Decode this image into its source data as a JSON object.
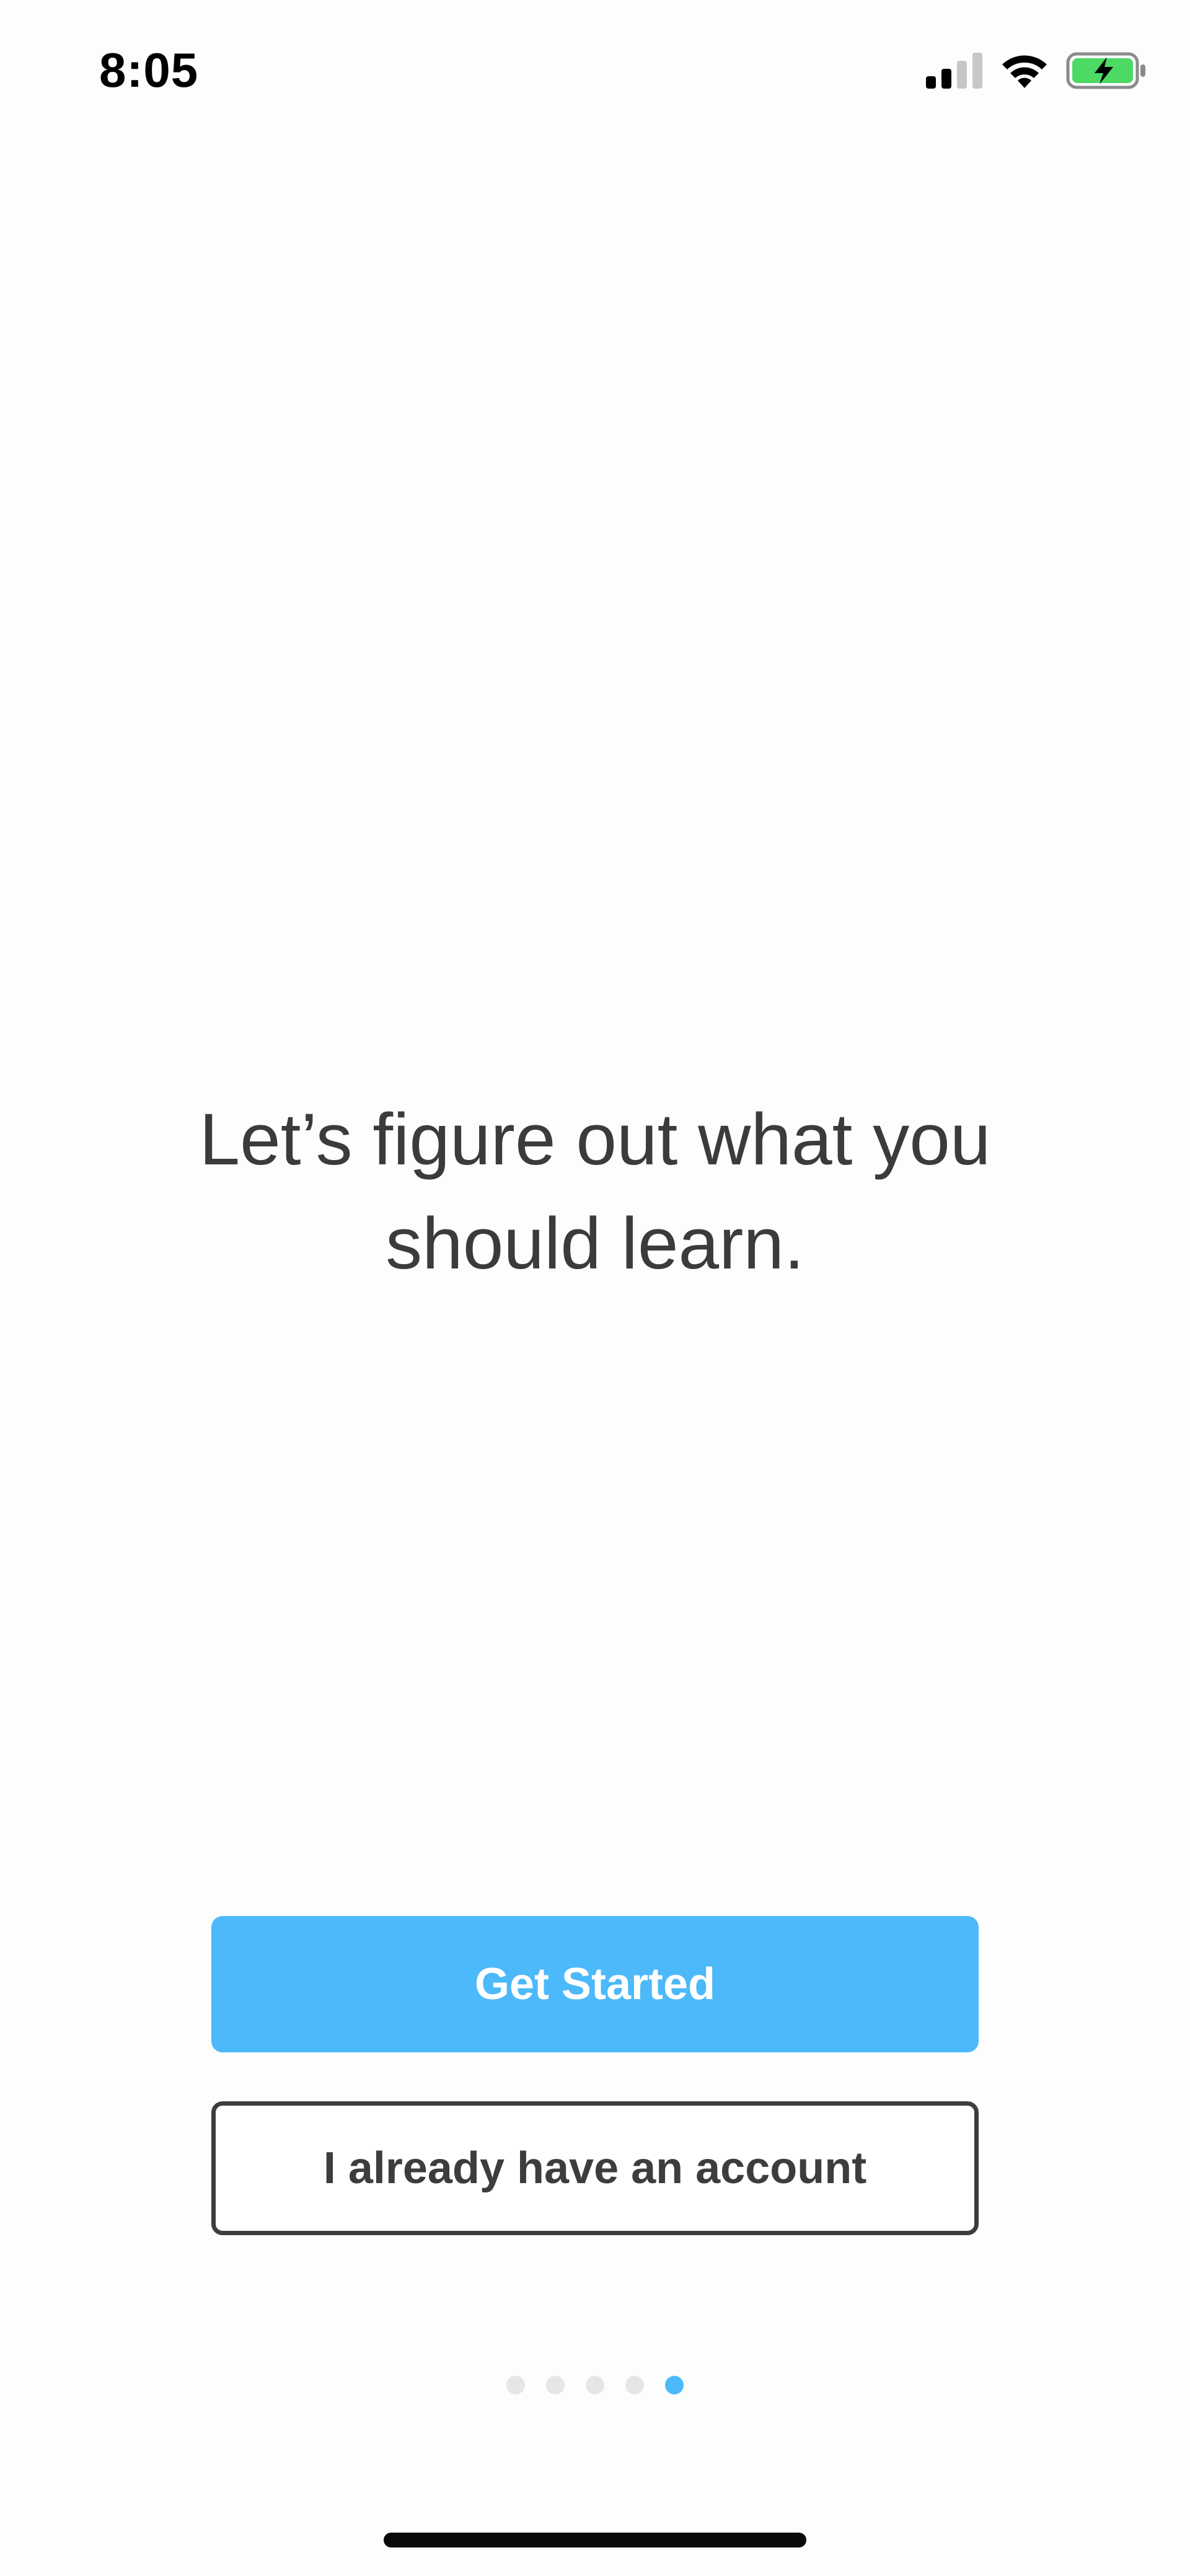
{
  "status_bar": {
    "time": "8:05",
    "icons": [
      "cellular-signal-icon",
      "wifi-icon",
      "battery-charging-icon"
    ],
    "battery_color": "#4cd964"
  },
  "onboarding": {
    "headline_line1": "Let’s figure out what you",
    "headline_line2": "should learn.",
    "primary_button_label": "Get Started",
    "secondary_button_label": "I already have an account",
    "page_count": 5,
    "active_page": 5,
    "accent_color": "#4cb9fa"
  }
}
